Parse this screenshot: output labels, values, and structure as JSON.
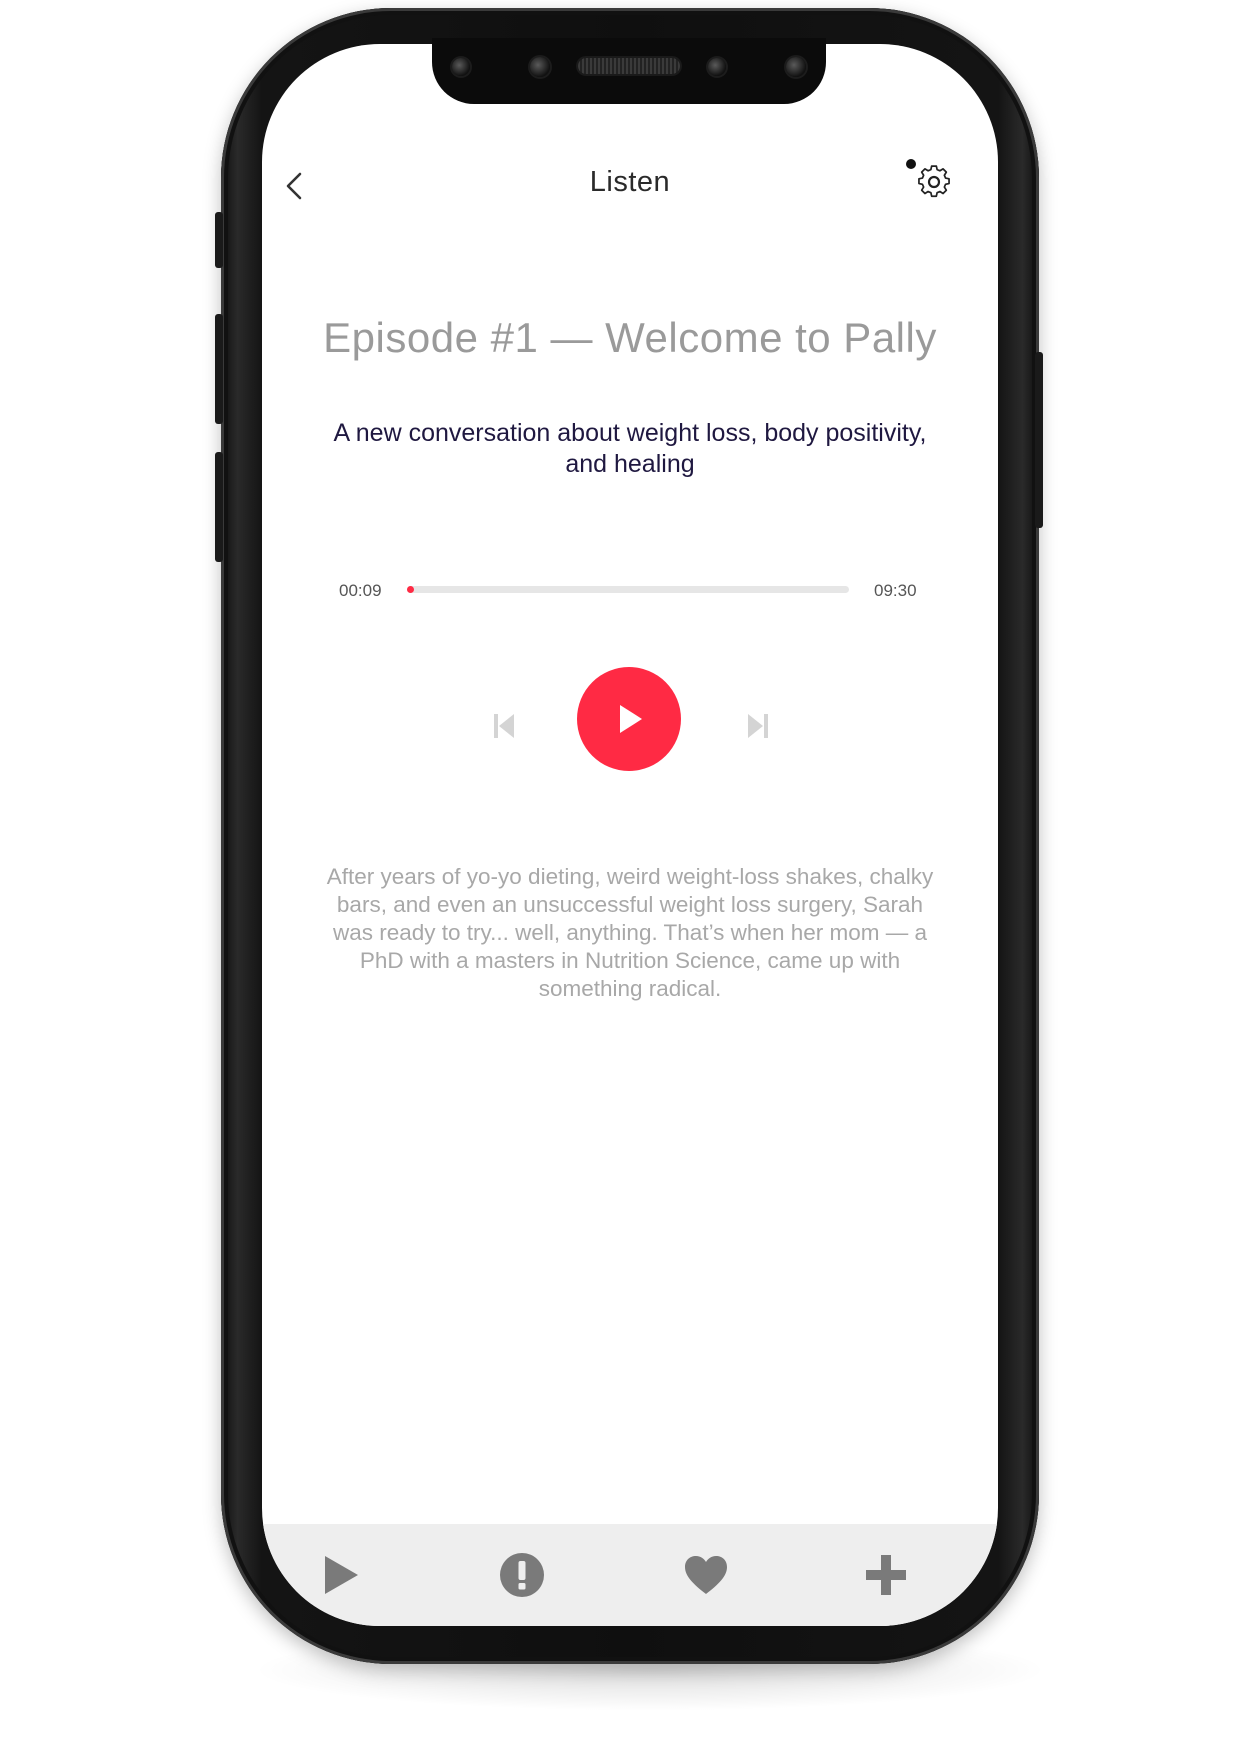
{
  "header": {
    "title": "Listen",
    "back_icon": "chevron-left-icon",
    "settings_icon": "gear-icon",
    "notification_dot": true
  },
  "episode": {
    "title": "Episode #1 — Welcome to Pally",
    "subtitle": "A new conversation about weight loss, body positivity, and healing",
    "description": "After years of yo-yo dieting, weird weight-loss shakes, chalky bars, and even an unsuccessful weight loss surgery, Sarah was ready to try... well, anything. That’s when her mom — a PhD with a masters in Nutrition Science, came up with something radical."
  },
  "player": {
    "current_time": "00:09",
    "total_time": "09:30",
    "progress_fraction": 0.016,
    "controls": [
      "skip-back-icon",
      "play-icon",
      "skip-forward-icon"
    ]
  },
  "tabbar": {
    "items": [
      {
        "icon": "play-icon"
      },
      {
        "icon": "alert-icon"
      },
      {
        "icon": "heart-icon"
      },
      {
        "icon": "plus-icon"
      }
    ]
  },
  "colors": {
    "accent": "#ff2a44",
    "title_gray": "#9a9a9a",
    "subtitle_ink": "#1f1840",
    "body_gray": "#a8a8a8",
    "tabbar_bg": "#eeeeee",
    "tab_icon": "#7a7a7a"
  }
}
